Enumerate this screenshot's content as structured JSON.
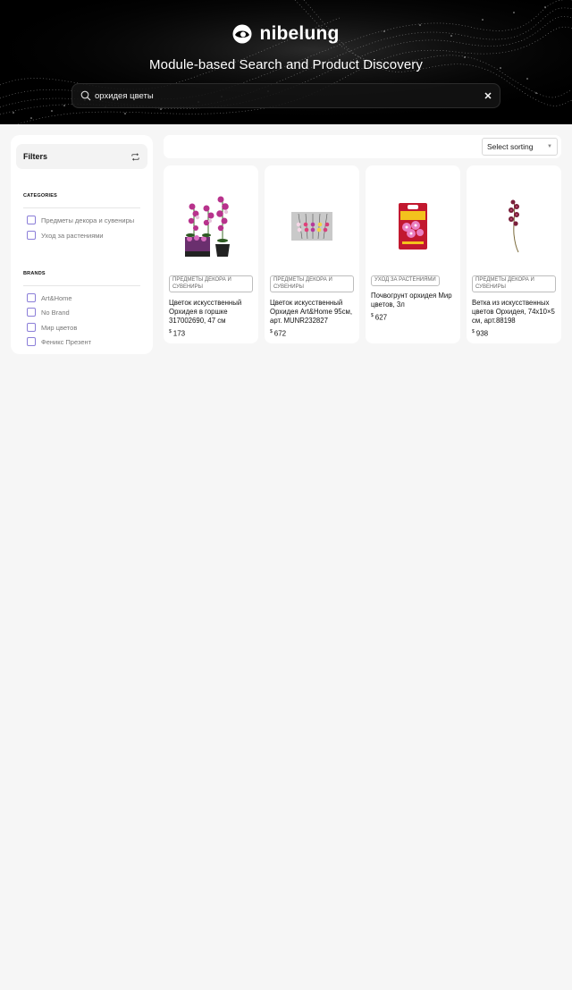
{
  "header": {
    "brand": "nibelung",
    "tagline": "Module-based Search and Product Discovery",
    "search": {
      "value": "орхидея цветы",
      "placeholder": ""
    }
  },
  "filters": {
    "title": "Filters",
    "categories": {
      "title": "CATEGORIES",
      "items": [
        "Предметы декора и сувениры",
        "Уход за растениями"
      ]
    },
    "brands": {
      "title": "BRANDS",
      "items": [
        "Art&Home",
        "No Brand",
        "Мир цветов",
        "Феникс Презент"
      ]
    }
  },
  "sorting": {
    "label": "Select sorting"
  },
  "products": [
    {
      "category": "ПРЕДМЕТЫ ДЕКОРА И СУВЕНИРЫ",
      "title": "Цветок искусственный Орхидея в горшке 317002690, 47 см",
      "currency": "$",
      "price": "173"
    },
    {
      "category": "ПРЕДМЕТЫ ДЕКОРА И СУВЕНИРЫ",
      "title": "Цветок искусственный Орхидея Art&Home 95см, арт. MUNR232827",
      "currency": "$",
      "price": "672"
    },
    {
      "category": "УХОД ЗА РАСТЕНИЯМИ",
      "title": "Почвогрунт орхидея Мир цветов, 3л",
      "currency": "$",
      "price": "627"
    },
    {
      "category": "ПРЕДМЕТЫ ДЕКОРА И СУВЕНИРЫ",
      "title": "Ветка из искусственных цветов Орхидея, 74х10×5 см, арт.88198",
      "currency": "$",
      "price": "938"
    }
  ],
  "icons": {
    "logo": "eye-logo-icon",
    "search": "search-icon",
    "clear": "close-icon",
    "reset": "refresh-icon",
    "sort": "chevron-down-icon"
  },
  "colors": {
    "header_bg": "#000000",
    "checkbox": "#8b7ed8",
    "page_bg": "#f6f6f6"
  }
}
